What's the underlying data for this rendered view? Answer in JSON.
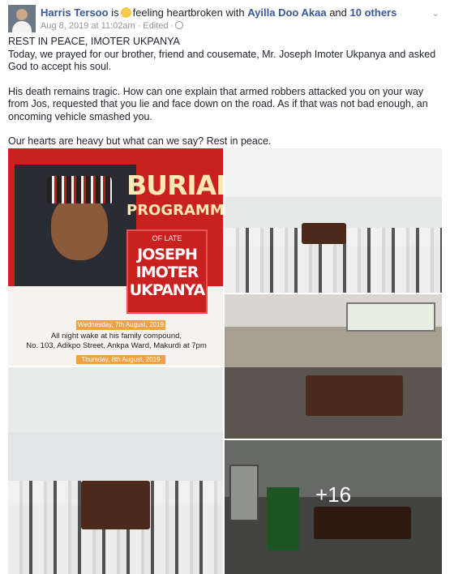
{
  "header": {
    "author": "Harris Tersoo",
    "connector": "is",
    "feeling": "feeling heartbroken",
    "with_word": "with",
    "tagged": "Ayilla Doo Akaa",
    "and_word": "and",
    "others": "10 others",
    "date": "Aug 8, 2019 at 11:02am",
    "edited": "Edited"
  },
  "post": {
    "line1": "REST IN PEACE, IMOTER UKPANYA",
    "line2": "Today, we prayed  for our brother, friend and cousemate, Mr. Joseph Imoter Ukpanya  and asked God to accept his soul.",
    "line3": "His death remains tragic. How can one explain that armed robbers attacked you on your way from Jos, requested that you lie and  face down on the road. As if that was not bad enough, an oncoming  vehicle smashed you.",
    "line4": "Our hearts are heavy but what can we say?  Rest in peace."
  },
  "poster": {
    "burial": "BURIAL",
    "programme": "PROGRAMME",
    "of_late": "OF LATE",
    "name1": "JOSEPH",
    "name2": "IMOTER",
    "name3": "UKPANYA",
    "date1": "Wednesday, 7th August, 2019",
    "info1": "All night wake at his family compound,",
    "info2": "No. 103, Adikpo Street, Ankpa Ward, Makurdi at 7pm",
    "date2": "Thursday, 8th August, 2019"
  },
  "gallery": {
    "more_count": "+16"
  },
  "colors": {
    "link": "#385898",
    "meta": "#90949c",
    "poster_red": "#c8211f"
  }
}
